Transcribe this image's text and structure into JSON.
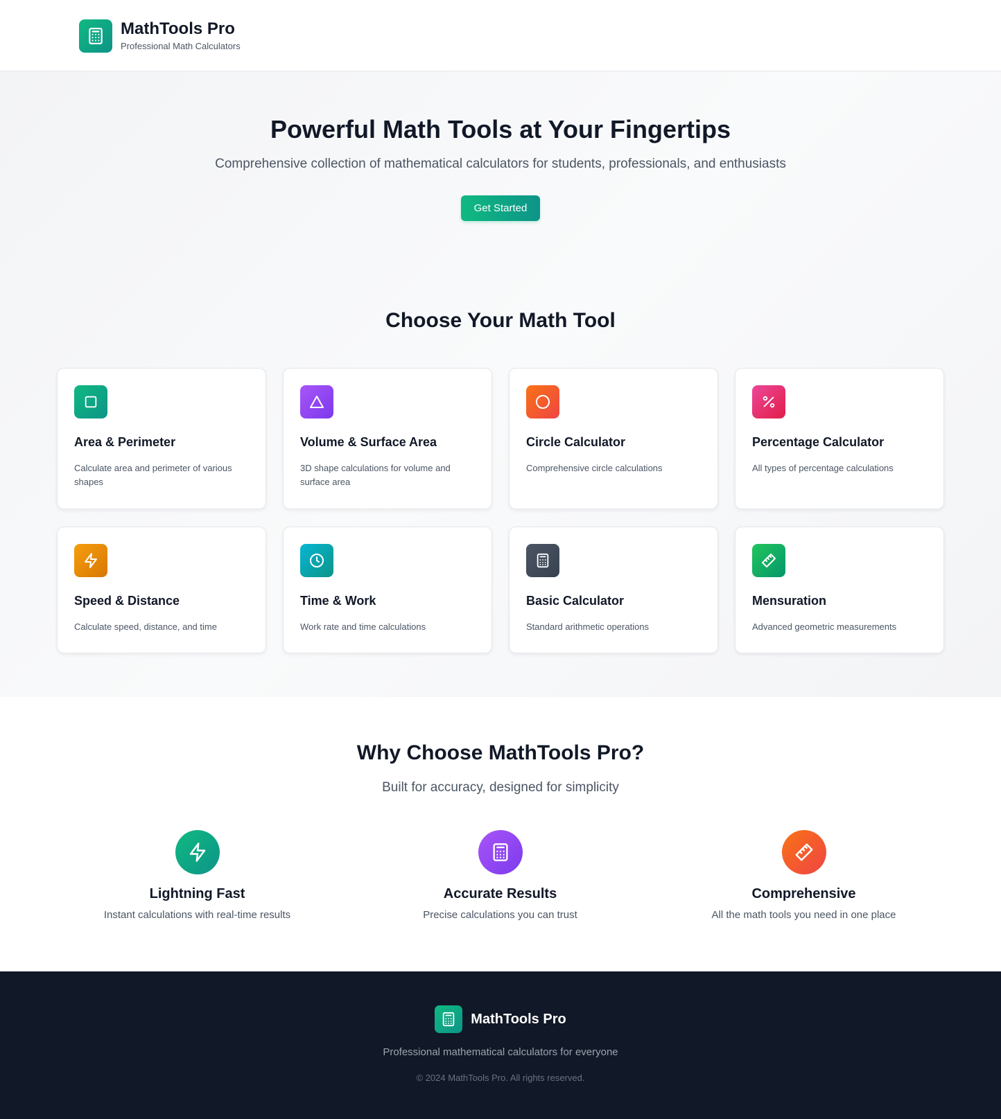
{
  "header": {
    "title": "MathTools Pro",
    "subtitle": "Professional Math Calculators",
    "logo_icon": "calculator-icon"
  },
  "hero": {
    "title": "Powerful Math Tools at Your Fingertips",
    "subtitle": "Comprehensive collection of mathematical calculators for students, professionals, and enthusiasts",
    "cta_label": "Get Started"
  },
  "tools": {
    "title": "Choose Your Math Tool",
    "items": [
      {
        "title": "Area & Perimeter",
        "desc": "Calculate area and perimeter of various shapes",
        "icon": "square-icon",
        "color_from": "#10b981",
        "color_to": "#0d9488"
      },
      {
        "title": "Volume & Surface Area",
        "desc": "3D shape calculations for volume and surface area",
        "icon": "triangle-icon",
        "color_from": "#a855f7",
        "color_to": "#7c3aed"
      },
      {
        "title": "Circle Calculator",
        "desc": "Comprehensive circle calculations",
        "icon": "circle-icon",
        "color_from": "#f97316",
        "color_to": "#ef4444"
      },
      {
        "title": "Percentage Calculator",
        "desc": "All types of percentage calculations",
        "icon": "percent-icon",
        "color_from": "#ec4899",
        "color_to": "#e11d48"
      },
      {
        "title": "Speed & Distance",
        "desc": "Calculate speed, distance, and time",
        "icon": "lightning-icon",
        "color_from": "#f59e0b",
        "color_to": "#d97706"
      },
      {
        "title": "Time & Work",
        "desc": "Work rate and time calculations",
        "icon": "clock-icon",
        "color_from": "#06b6d4",
        "color_to": "#0d9488"
      },
      {
        "title": "Basic Calculator",
        "desc": "Standard arithmetic operations",
        "icon": "calculator-icon",
        "color_from": "#4b5563",
        "color_to": "#374151"
      },
      {
        "title": "Mensuration",
        "desc": "Advanced geometric measurements",
        "icon": "ruler-icon",
        "color_from": "#22c55e",
        "color_to": "#059669"
      }
    ]
  },
  "why": {
    "title": "Why Choose MathTools Pro?",
    "subtitle": "Built for accuracy, designed for simplicity",
    "features": [
      {
        "title": "Lightning Fast",
        "desc": "Instant calculations with real-time results",
        "icon": "lightning-icon",
        "color_from": "#10b981",
        "color_to": "#0d9488"
      },
      {
        "title": "Accurate Results",
        "desc": "Precise calculations you can trust",
        "icon": "calculator-icon",
        "color_from": "#a855f7",
        "color_to": "#7c3aed"
      },
      {
        "title": "Comprehensive",
        "desc": "All the math tools you need in one place",
        "icon": "ruler-icon",
        "color_from": "#f97316",
        "color_to": "#ef4444"
      }
    ]
  },
  "footer": {
    "name": "MathTools Pro",
    "tagline": "Professional mathematical calculators for everyone",
    "copyright": "© 2024 MathTools Pro. All rights reserved."
  }
}
